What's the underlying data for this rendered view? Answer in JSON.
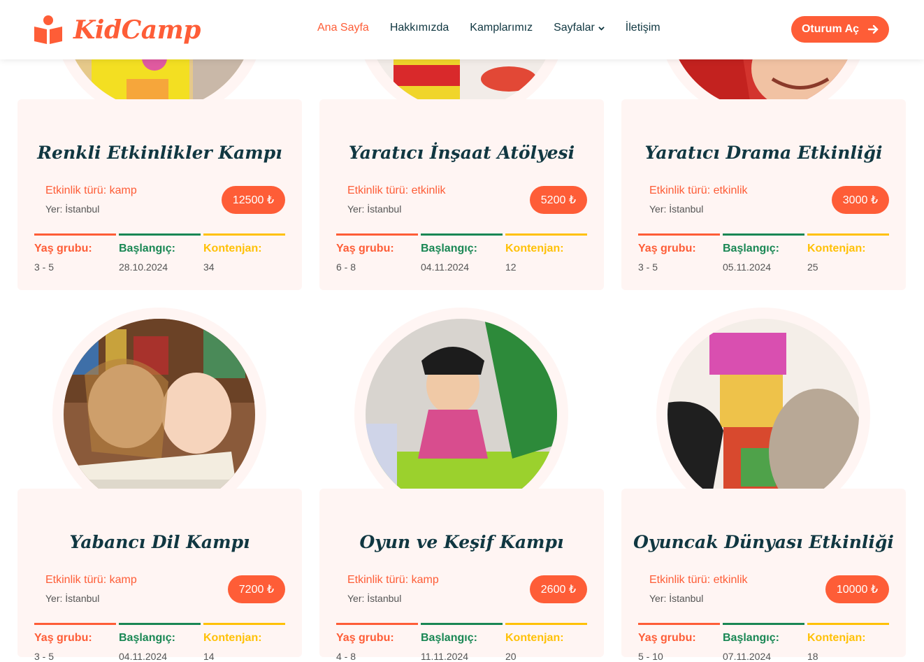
{
  "brand": {
    "name": "KidCamp",
    "color": "#fe5d37"
  },
  "nav": [
    {
      "label": "Ana Sayfa",
      "active": true
    },
    {
      "label": "Hakkımızda"
    },
    {
      "label": "Kamplarımız"
    },
    {
      "label": "Sayfalar",
      "dropdown": true
    },
    {
      "label": "İletişim"
    }
  ],
  "login": {
    "label": "Oturum Aç",
    "icon": "arrow-right-icon"
  },
  "stat_labels": {
    "age": "Yaş grubu:",
    "start": "Başlangıç:",
    "capacity": "Kontenjan:"
  },
  "cards": [
    {
      "title": "Renkli Etkinlikler Kampı",
      "type": "Etkinlik türü: kamp",
      "place": "Yer: İstanbul",
      "price": "12500 ₺",
      "age": "3 - 5",
      "start": "28.10.2024",
      "capacity": "34"
    },
    {
      "title": "Yaratıcı İnşaat Atölyesi",
      "type": "Etkinlik türü: etkinlik",
      "place": "Yer: İstanbul",
      "price": "5200 ₺",
      "age": "6 - 8",
      "start": "04.11.2024",
      "capacity": "12"
    },
    {
      "title": "Yaratıcı Drama Etkinliği",
      "type": "Etkinlik türü: etkinlik",
      "place": "Yer: İstanbul",
      "price": "3000 ₺",
      "age": "3 - 5",
      "start": "05.11.2024",
      "capacity": "25"
    },
    {
      "title": "Yabancı Dil Kampı",
      "type": "Etkinlik türü: kamp",
      "place": "Yer: İstanbul",
      "price": "7200 ₺",
      "age": "3 - 5",
      "start": "04.11.2024",
      "capacity": "14"
    },
    {
      "title": "Oyun ve Keşif Kampı",
      "type": "Etkinlik türü: kamp",
      "place": "Yer: İstanbul",
      "price": "2600 ₺",
      "age": "4 - 8",
      "start": "11.11.2024",
      "capacity": "20"
    },
    {
      "title": "Oyuncak Dünyası Etkinliği",
      "type": "Etkinlik türü: etkinlik",
      "place": "Yer: İstanbul",
      "price": "10000 ₺",
      "age": "5 - 10",
      "start": "07.11.2024",
      "capacity": "18"
    }
  ]
}
